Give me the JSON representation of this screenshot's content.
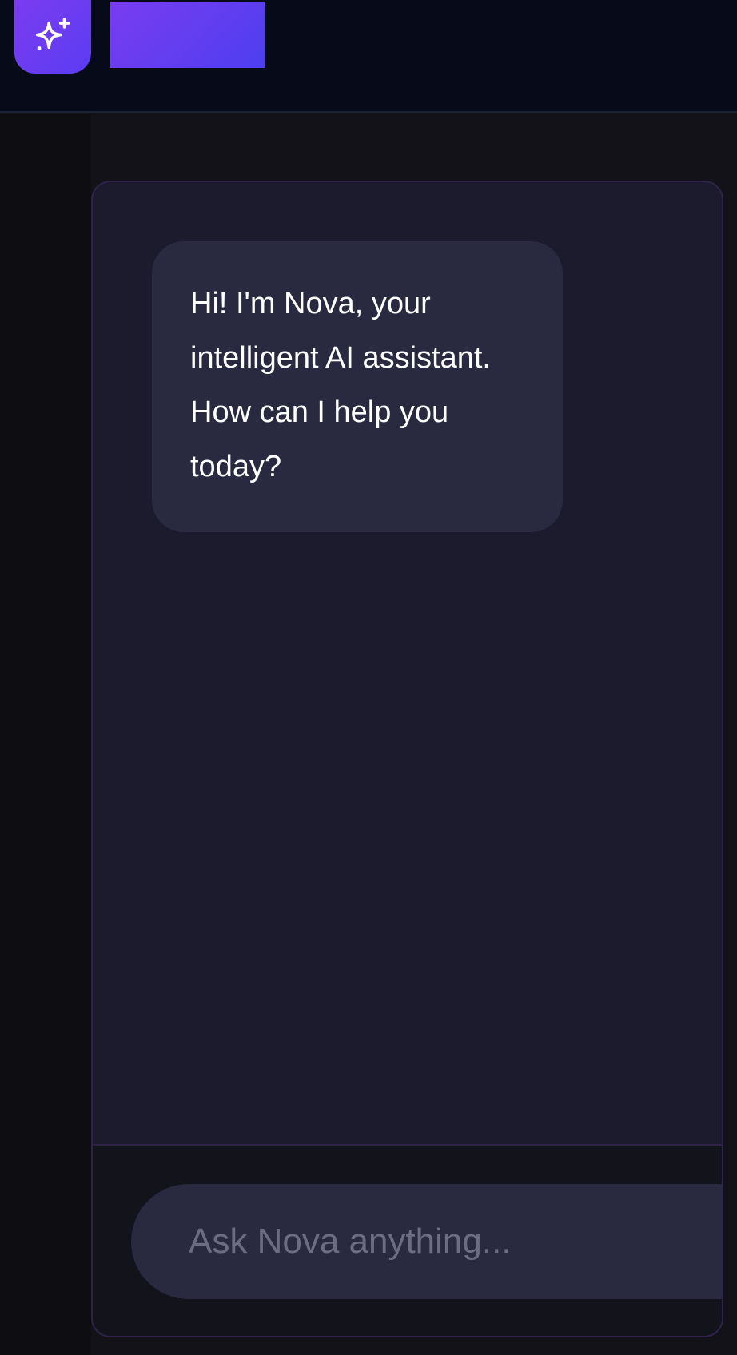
{
  "header": {
    "logo_icon": "sparkle-icon",
    "brand_color_start": "#7b3cf0",
    "brand_color_end": "#4d3ff0"
  },
  "chat": {
    "messages": [
      {
        "role": "assistant",
        "text": "Hi! I'm Nova, your intelligent AI assistant. How can I help you today?"
      }
    ]
  },
  "composer": {
    "placeholder": "Ask Nova anything...",
    "value": ""
  },
  "colors": {
    "panel_bg": "#1b1b2d",
    "bubble_bg": "#292a40",
    "border": "#2f2448"
  }
}
